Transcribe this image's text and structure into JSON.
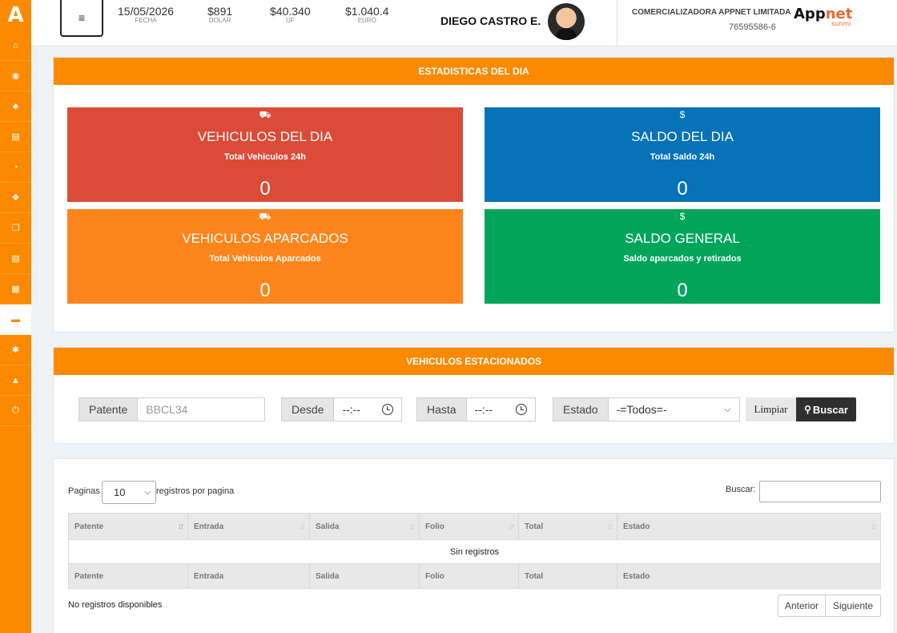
{
  "sidebar": {
    "logo": "A",
    "items": [
      {
        "icon": "bank-icon",
        "glyph": "⌂"
      },
      {
        "icon": "target-icon",
        "glyph": "◉"
      },
      {
        "icon": "sitemap-icon",
        "glyph": "♣"
      },
      {
        "icon": "printer-icon",
        "glyph": "▤"
      },
      {
        "icon": "pie-chart-icon",
        "glyph": "◔"
      },
      {
        "icon": "dropbox-icon",
        "glyph": "❖"
      },
      {
        "icon": "copy-icon",
        "glyph": "❐"
      },
      {
        "icon": "printer-icon",
        "glyph": "▤"
      },
      {
        "icon": "document-icon",
        "glyph": "▦"
      },
      {
        "icon": "car-icon",
        "glyph": "▬",
        "active": true
      },
      {
        "icon": "cogs-icon",
        "glyph": "✱"
      },
      {
        "icon": "lock-icon",
        "glyph": "▲"
      },
      {
        "icon": "power-icon",
        "glyph": "⏻"
      }
    ]
  },
  "header": {
    "menu_glyph": "≡",
    "fecha": {
      "value": "15/05/2026",
      "label": "FECHA"
    },
    "dolar": {
      "value": "$891",
      "label": "DOLAR"
    },
    "uf": {
      "value": "$40.340",
      "label": "UF"
    },
    "euro": {
      "value": "$1.040.4",
      "label": "EURO"
    },
    "user_name": "DIEGO CASTRO E.",
    "company": "COMERCIALIZADORA APPNET LIMITADA",
    "rut": "76595586-6",
    "brand_part1": "App",
    "brand_part2": "net",
    "brand_sub": "sunmi"
  },
  "stats": {
    "title": "ESTADISTICAS DEL DIA",
    "cards": [
      {
        "icon": "car-icon",
        "glyph": "⛟",
        "title": "VEHICULOS DEL DIA",
        "subtitle": "Total Vehiculos 24h",
        "value": "0",
        "color": "#dc4b38"
      },
      {
        "icon": "dollar-icon",
        "glyph": "$",
        "title": "SALDO DEL DIA",
        "subtitle": "Total Saldo 24h",
        "value": "0",
        "color": "#0672b8"
      },
      {
        "icon": "car-icon",
        "glyph": "⛟",
        "title": "VEHICULOS APARCADOS",
        "subtitle": "Total Vehiculos Aparcados",
        "value": "0",
        "color": "#fe851b"
      },
      {
        "icon": "dollar-icon",
        "glyph": "$",
        "title": "SALDO GENERAL",
        "subtitle": "Saldo aparcados y retirados",
        "value": "0",
        "color": "#00a55a"
      }
    ]
  },
  "filter": {
    "title": "VEHICULOS ESTACIONADOS",
    "patente_label": "Patente",
    "patente_placeholder": "BBCL34",
    "desde_label": "Desde",
    "desde_value": "--:--",
    "hasta_label": "Hasta",
    "hasta_value": "--:--",
    "estado_label": "Estado",
    "estado_value": "-=Todos=-",
    "limpiar": "Limpiar",
    "buscar": "Buscar"
  },
  "table": {
    "paginas_label": "Paginas",
    "page_size": "10",
    "per_page_label": "registros por pagina",
    "search_label": "Buscar:",
    "columns": [
      "Patente",
      "Entrada",
      "Salida",
      "Folio",
      "Total",
      "Estado"
    ],
    "empty_text": "Sin registros",
    "info_text": "No registros disponibles",
    "prev": "Anterior",
    "next": "Siguiente"
  }
}
